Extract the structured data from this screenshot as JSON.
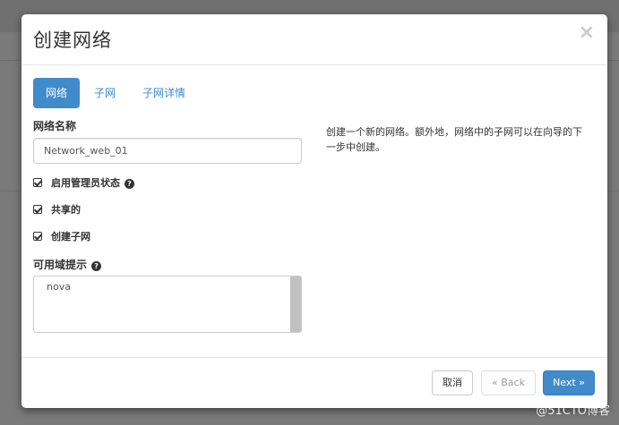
{
  "modal": {
    "title": "创建网络",
    "close_glyph": "×"
  },
  "tabs": [
    {
      "label": "网络",
      "active": true
    },
    {
      "label": "子网",
      "active": false
    },
    {
      "label": "子网详情",
      "active": false
    }
  ],
  "form": {
    "network_name_label": "网络名称",
    "network_name_value": "Network_web_01",
    "admin_state_label": "启用管理员状态",
    "shared_label": "共享的",
    "create_subnet_label": "创建子网",
    "az_hint_label": "可用域提示",
    "az_options": [
      "nova"
    ]
  },
  "description": "创建一个新的网络。额外地，网络中的子网可以在向导的下一步中创建。",
  "footer": {
    "cancel_label": "取消",
    "back_label": "« Back",
    "next_label": "Next »"
  },
  "watermark": "@51CTO博客",
  "colors": {
    "primary": "#428bca",
    "backdrop": "#7a7a7a"
  }
}
